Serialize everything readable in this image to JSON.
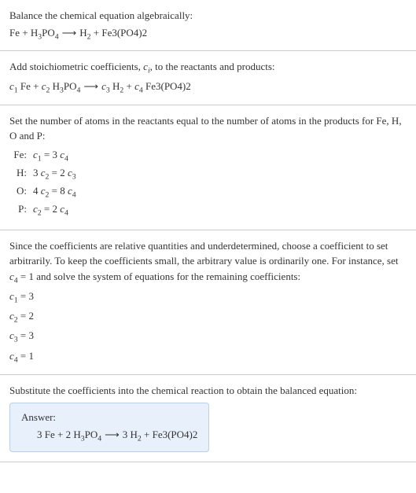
{
  "section1": {
    "intro": "Balance the chemical equation algebraically:",
    "eq_lhs1": "Fe + H",
    "eq_sub1": "3",
    "eq_mid1": "PO",
    "eq_sub2": "4",
    "eq_arrow": " ⟶ ",
    "eq_rhs1": "H",
    "eq_sub3": "2",
    "eq_rhs2": " + Fe3(PO4)2"
  },
  "section2": {
    "intro1": "Add stoichiometric coefficients, ",
    "ci_c": "c",
    "ci_i": "i",
    "intro2": ", to the reactants and products:",
    "c1": "c",
    "n1": "1",
    "t1": " Fe + ",
    "c2": "c",
    "n2": "2",
    "t2": " H",
    "s1": "3",
    "t3": "PO",
    "s2": "4",
    "arrow": " ⟶ ",
    "c3": "c",
    "n3": "3",
    "t4": " H",
    "s3": "2",
    "t5": " + ",
    "c4": "c",
    "n4": "4",
    "t6": " Fe3(PO4)2"
  },
  "section3": {
    "intro": "Set the number of atoms in the reactants equal to the number of atoms in the products for Fe, H, O and P:",
    "rows": [
      {
        "label": "Fe:",
        "c_a": "c",
        "sub_a": "1",
        "mid": " = 3 ",
        "c_b": "c",
        "sub_b": "4"
      },
      {
        "label": "H:",
        "pre": "3 ",
        "c_a": "c",
        "sub_a": "2",
        "mid": " = 2 ",
        "c_b": "c",
        "sub_b": "3"
      },
      {
        "label": "O:",
        "pre": "4 ",
        "c_a": "c",
        "sub_a": "2",
        "mid": " = 8 ",
        "c_b": "c",
        "sub_b": "4"
      },
      {
        "label": "P:",
        "c_a": "c",
        "sub_a": "2",
        "mid": " = 2 ",
        "c_b": "c",
        "sub_b": "4"
      }
    ]
  },
  "section4": {
    "intro": "Since the coefficients are relative quantities and underdetermined, choose a coefficient to set arbitrarily. To keep the coefficients small, the arbitrary value is ordinarily one. For instance, set ",
    "c4": "c",
    "n4": "4",
    "intro2": " = 1 and solve the system of equations for the remaining coefficients:",
    "solutions": [
      {
        "c": "c",
        "sub": "1",
        "val": " = 3"
      },
      {
        "c": "c",
        "sub": "2",
        "val": " = 2"
      },
      {
        "c": "c",
        "sub": "3",
        "val": " = 3"
      },
      {
        "c": "c",
        "sub": "4",
        "val": " = 1"
      }
    ]
  },
  "section5": {
    "intro": "Substitute the coefficients into the chemical reaction to obtain the balanced equation:",
    "answer_label": "Answer:",
    "eq_p1": "3 Fe + 2 H",
    "eq_s1": "3",
    "eq_p2": "PO",
    "eq_s2": "4",
    "eq_arrow": " ⟶ ",
    "eq_p3": "3 H",
    "eq_s3": "2",
    "eq_p4": " + Fe3(PO4)2"
  }
}
